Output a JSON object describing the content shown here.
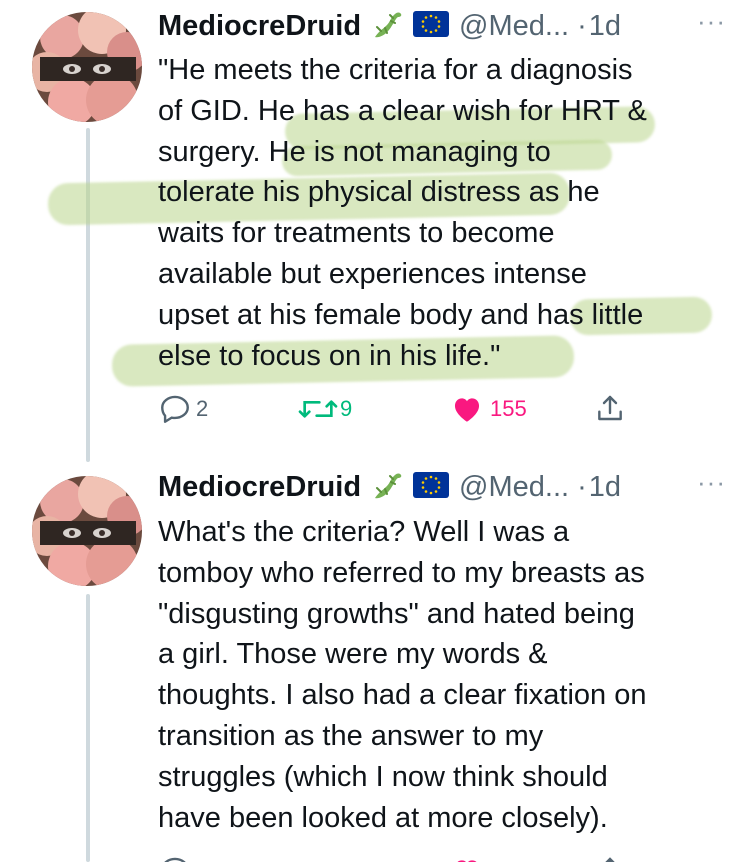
{
  "tweets": [
    {
      "author": {
        "name": "MediocreDruid",
        "handle": "@Med...",
        "time": "1d",
        "dot": "·",
        "more": "···"
      },
      "lines": [
        "\"He meets the criteria for a diagnosis",
        "of GID. He has a clear wish for HRT &",
        "surgery. He is not managing to",
        "tolerate his physical distress as he",
        "waits for treatments to become",
        "available but experiences intense",
        "upset at his female body and has little",
        "else to focus on in his life.\""
      ],
      "actions": {
        "reply": "2",
        "retweet": "9",
        "like": "155"
      }
    },
    {
      "author": {
        "name": "MediocreDruid",
        "handle": "@Med...",
        "time": "1d",
        "dot": "·",
        "more": "···"
      },
      "lines": [
        "What's the criteria? Well I was a",
        "tomboy who referred to my breasts as",
        "\"disgusting growths\" and hated being",
        "a girl. Those were my words &",
        "thoughts. I also had a clear fixation on",
        "transition as the answer to my",
        "struggles (which I now think should",
        "have been looked at more closely)."
      ]
    }
  ],
  "colors": {
    "text": "#0f1419",
    "muted": "#536471",
    "like": "#f91880",
    "retweet": "#00ba7c",
    "highlight": "#bad68c"
  },
  "icons": [
    "lizard-emoji-icon",
    "eu-flag-icon",
    "reply-icon",
    "retweet-icon",
    "heart-icon",
    "share-icon",
    "more-icon"
  ]
}
